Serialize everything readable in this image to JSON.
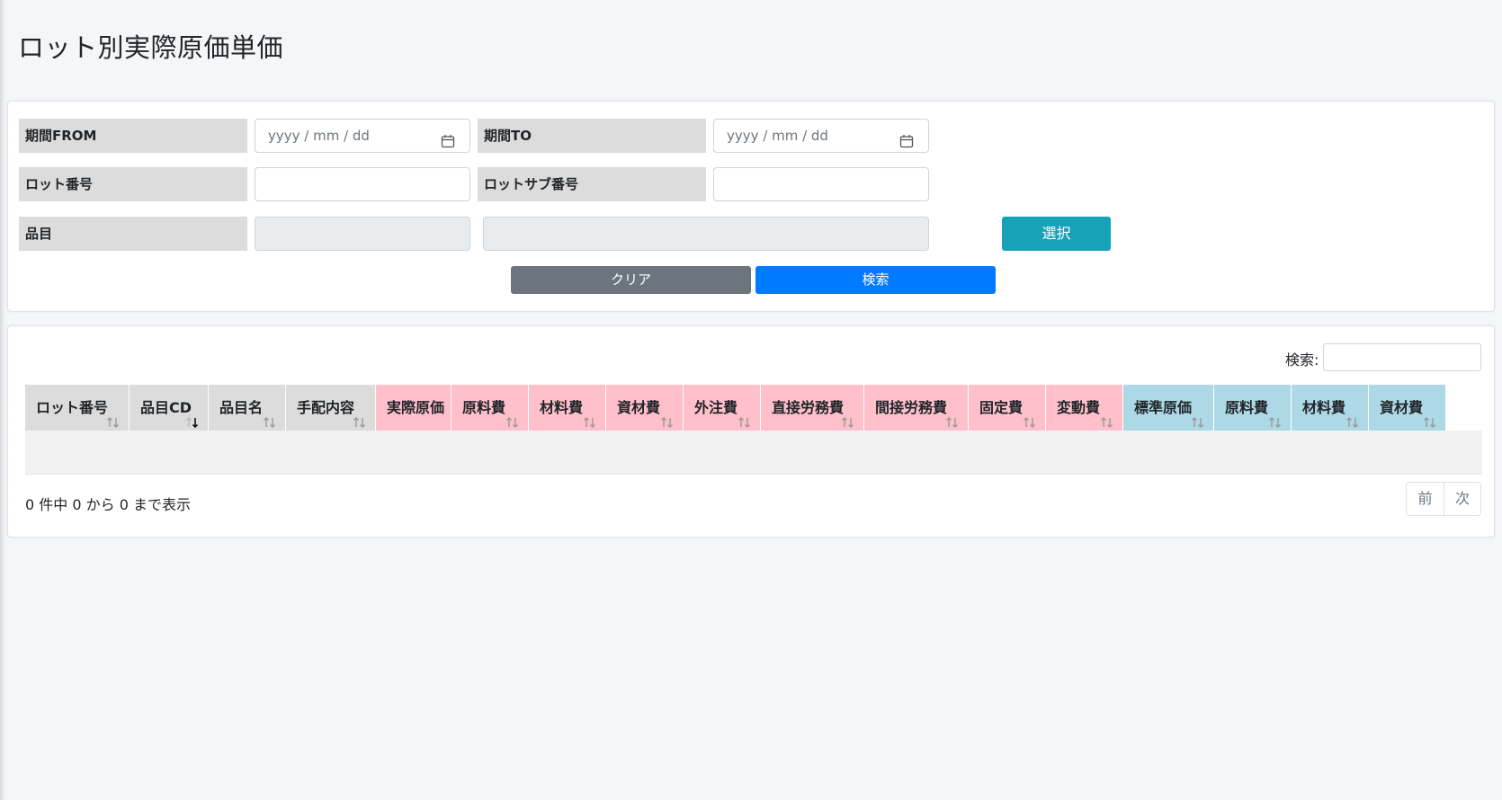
{
  "page": {
    "title": "ロット別実際原価単価"
  },
  "form": {
    "period_from_label": "期間FROM",
    "period_from_placeholder": "yyyy / mm / dd",
    "period_to_label": "期間TO",
    "period_to_placeholder": "yyyy / mm / dd",
    "lot_no_label": "ロット番号",
    "lot_no_value": "",
    "lot_sub_no_label": "ロットサブ番号",
    "lot_sub_no_value": "",
    "item_label": "品目",
    "item_code_value": "",
    "item_name_value": "",
    "select_button": "選択",
    "clear_button": "クリア",
    "search_button": "検索"
  },
  "table": {
    "search_label": "検索:",
    "search_value": "",
    "columns": [
      {
        "label": "ロット番号",
        "group": "gray",
        "sort": "both"
      },
      {
        "label": "品目CD",
        "group": "gray",
        "sort": "desc"
      },
      {
        "label": "品目名",
        "group": "gray",
        "sort": "both"
      },
      {
        "label": "手配内容",
        "group": "gray",
        "sort": "both"
      },
      {
        "label": "実際原価",
        "group": "pink",
        "sort": "none"
      },
      {
        "label": "原料費",
        "group": "pink",
        "sort": "both"
      },
      {
        "label": "材料費",
        "group": "pink",
        "sort": "both"
      },
      {
        "label": "資材費",
        "group": "pink",
        "sort": "both"
      },
      {
        "label": "外注費",
        "group": "pink",
        "sort": "both"
      },
      {
        "label": "直接労務費",
        "group": "pink",
        "sort": "both"
      },
      {
        "label": "間接労務費",
        "group": "pink",
        "sort": "both"
      },
      {
        "label": "固定費",
        "group": "pink",
        "sort": "both"
      },
      {
        "label": "変動費",
        "group": "pink",
        "sort": "both"
      },
      {
        "label": "標準原価",
        "group": "blue",
        "sort": "both"
      },
      {
        "label": "原料費",
        "group": "blue",
        "sort": "both"
      },
      {
        "label": "材料費",
        "group": "blue",
        "sort": "both"
      },
      {
        "label": "資材費",
        "group": "blue",
        "sort": "both"
      }
    ],
    "rows": [],
    "info": "0 件中 0 から 0 まで表示",
    "prev_button": "前",
    "next_button": "次"
  },
  "colors": {
    "gray_header": "#dcdcdc",
    "pink_header": "#ffc0cb",
    "blue_header": "#add8e6",
    "select_button": "#17a2b8",
    "clear_button": "#6c757d",
    "search_button": "#007bff"
  }
}
